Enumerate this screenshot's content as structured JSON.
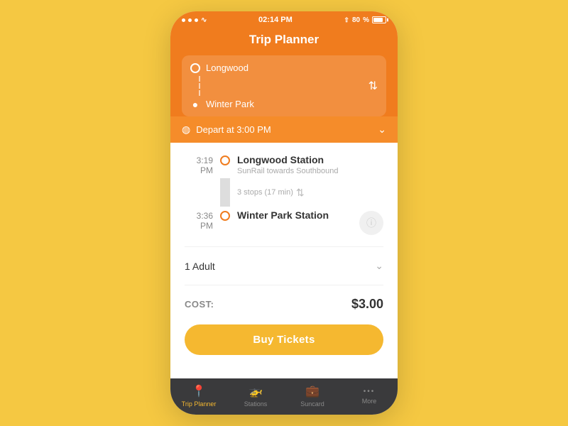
{
  "statusBar": {
    "time": "02:14 PM",
    "battery": "80%",
    "batteryLabel": "80"
  },
  "header": {
    "title": "Trip Planner"
  },
  "route": {
    "origin": "Longwood",
    "destination": "Winter Park",
    "swapLabel": "⇅"
  },
  "depart": {
    "label": "Depart at 3:00 PM"
  },
  "trip": {
    "stops": [
      {
        "time": "3:19 PM",
        "name": "Longwood Station",
        "sub": "SunRail towards Southbound"
      },
      {
        "time": "3:36 PM",
        "name": "Winter Park Station",
        "sub": ""
      }
    ],
    "connector": {
      "stopsLabel": "3 stops (17 min)"
    }
  },
  "passengers": {
    "label": "1 Adult"
  },
  "cost": {
    "label": "COST:",
    "value": "$3.00"
  },
  "buyButton": {
    "label": "Buy Tickets"
  },
  "nav": {
    "items": [
      {
        "id": "trip-planner",
        "label": "Trip Planner",
        "icon": "📍",
        "active": true
      },
      {
        "id": "stations",
        "label": "Stations",
        "icon": "🚉",
        "active": false
      },
      {
        "id": "suncard",
        "label": "Suncard",
        "icon": "🪪",
        "active": false
      },
      {
        "id": "more",
        "label": "More",
        "icon": "···",
        "active": false
      }
    ]
  }
}
